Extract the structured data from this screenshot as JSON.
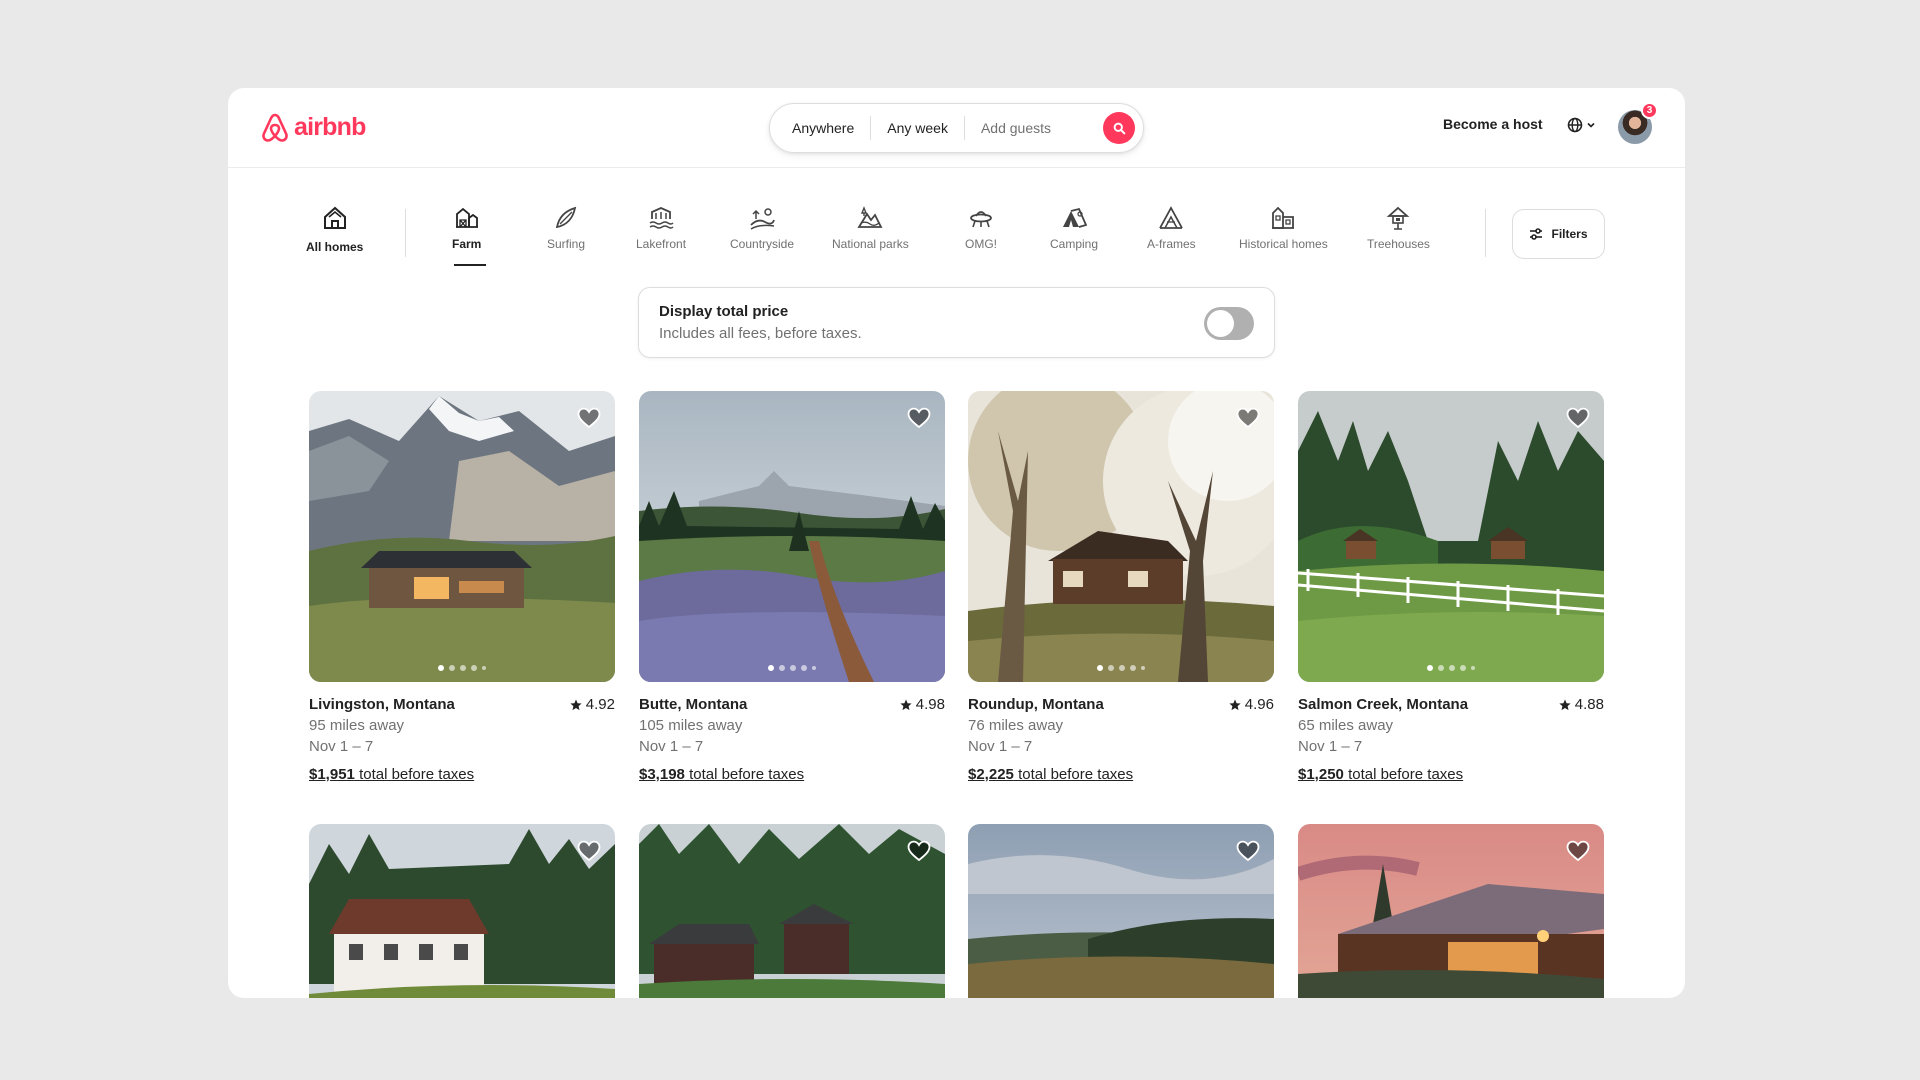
{
  "brand": {
    "name": "airbnb",
    "color": "#ff385c"
  },
  "search": {
    "anywhere": "Anywhere",
    "any_week": "Any week",
    "add_guests": "Add guests"
  },
  "header": {
    "become_host": "Become a host",
    "notification_count": "3"
  },
  "categories": [
    {
      "label": "All homes",
      "icon": "home-icon"
    },
    {
      "label": "Farm",
      "icon": "farm-icon",
      "active": true
    },
    {
      "label": "Surfing",
      "icon": "surfboard-icon"
    },
    {
      "label": "Lakefront",
      "icon": "lakefront-icon"
    },
    {
      "label": "Countryside",
      "icon": "countryside-icon"
    },
    {
      "label": "National parks",
      "icon": "national-park-icon"
    },
    {
      "label": "OMG!",
      "icon": "ufo-icon"
    },
    {
      "label": "Camping",
      "icon": "tent-icon"
    },
    {
      "label": "A-frames",
      "icon": "a-frame-icon"
    },
    {
      "label": "Historical homes",
      "icon": "historical-home-icon"
    },
    {
      "label": "Treehouses",
      "icon": "treehouse-icon"
    }
  ],
  "filters_label": "Filters",
  "total_price": {
    "title": "Display total price",
    "subtitle": "Includes all fees, before taxes.",
    "enabled": false
  },
  "listings": [
    {
      "title": "Livingston, Montana",
      "rating": "4.92",
      "distance": "95 miles away",
      "dates": "Nov 1 – 7",
      "price": "$1,951",
      "price_suffix": "total before taxes"
    },
    {
      "title": "Butte, Montana",
      "rating": "4.98",
      "distance": "105 miles away",
      "dates": "Nov 1 – 7",
      "price": "$3,198",
      "price_suffix": "total before taxes"
    },
    {
      "title": "Roundup, Montana",
      "rating": "4.96",
      "distance": "76 miles away",
      "dates": "Nov 1 – 7",
      "price": "$2,225",
      "price_suffix": "total before taxes"
    },
    {
      "title": "Salmon Creek, Montana",
      "rating": "4.88",
      "distance": "65 miles away",
      "dates": "Nov 1 – 7",
      "price": "$1,250",
      "price_suffix": "total before taxes"
    }
  ]
}
